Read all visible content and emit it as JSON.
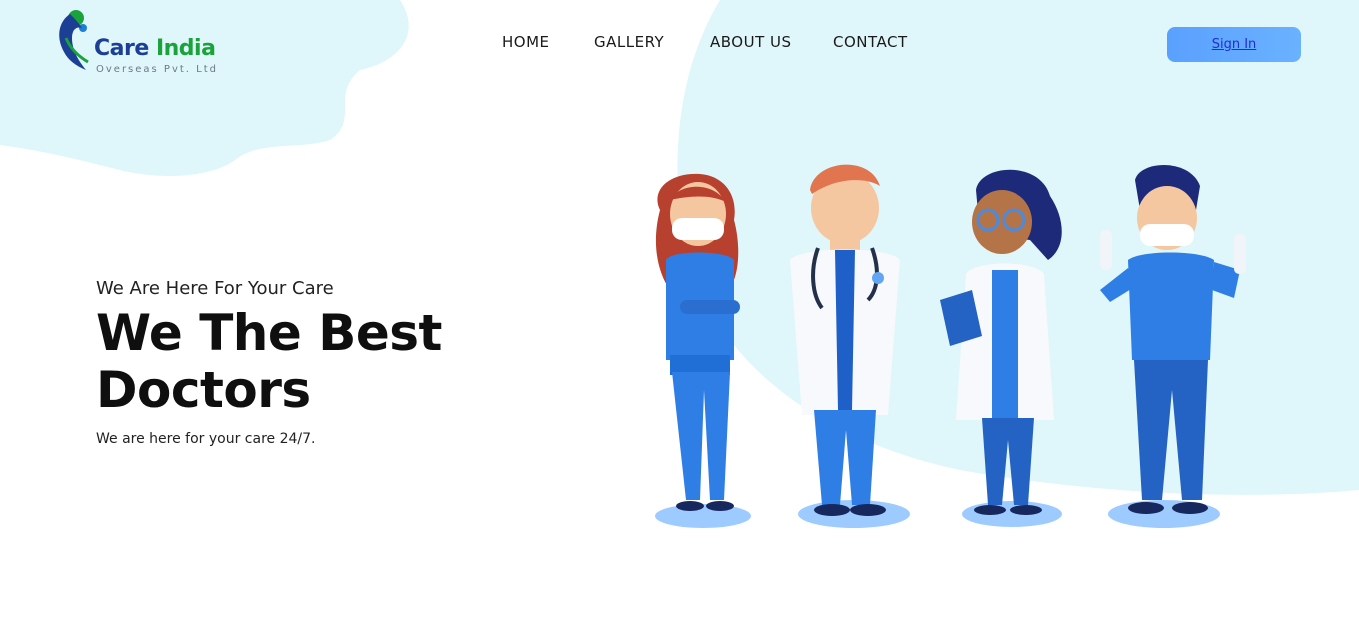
{
  "brand": {
    "name_part1": "Care",
    "name_part2": "India",
    "subtitle": "Overseas Pvt. Ltd",
    "colors": {
      "primary": "#1b3f95",
      "green": "#1aa33a"
    }
  },
  "nav": {
    "items": [
      {
        "label": "HOME"
      },
      {
        "label": "GALLERY"
      },
      {
        "label": "ABOUT US"
      },
      {
        "label": "CONTACT"
      }
    ],
    "signin_label": "Sign In"
  },
  "hero": {
    "tagline": "We Are Here For Your Care",
    "title": "We The Best Doctors",
    "description": "We are here for your care 24/7."
  },
  "theme": {
    "blob_color": "#dff6fa",
    "accent_blue": "#2f7ee6",
    "button_gradient": [
      "#5aa0ff",
      "#6ab2ff"
    ]
  },
  "illustration": {
    "icon": "doctors-illustration"
  }
}
